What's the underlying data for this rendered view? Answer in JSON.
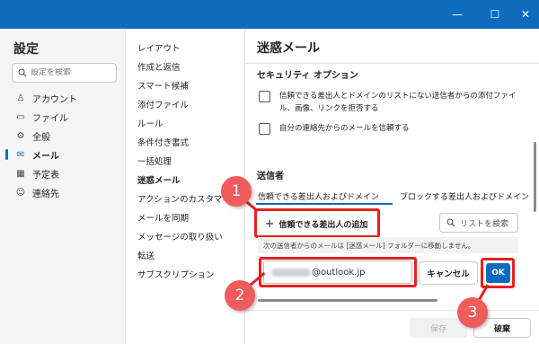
{
  "window": {
    "minimize_glyph": "—",
    "maximize_glyph": "☐",
    "close_glyph": "✕",
    "accent": "#0f6cbd"
  },
  "left": {
    "title": "設定",
    "search_placeholder": "設定を検索",
    "items": [
      {
        "label": "アカウント",
        "icon": "person-icon",
        "glyph": "♙"
      },
      {
        "label": "ファイル",
        "icon": "folder-icon",
        "glyph": "▭"
      },
      {
        "label": "全般",
        "icon": "gear-icon",
        "glyph": "⚙"
      },
      {
        "label": "メール",
        "icon": "mail-icon",
        "glyph": "✉",
        "active": true
      },
      {
        "label": "予定表",
        "icon": "calendar-icon",
        "glyph": "▦"
      },
      {
        "label": "連絡先",
        "icon": "contacts-icon",
        "glyph": "☺"
      }
    ]
  },
  "middle": {
    "items": [
      "レイアウト",
      "作成と返信",
      "スマート候補",
      "添付ファイル",
      "ルール",
      "条件付き書式",
      "一括処理",
      "迷惑メール",
      "アクションのカスタマイズ",
      "メールを同期",
      "メッセージの取り扱い",
      "転送",
      "サブスクリプション"
    ],
    "active_index": 7
  },
  "right": {
    "title": "迷惑メール",
    "security_title": "セキュリティ オプション",
    "option1": "信頼できる差出人とドメインのリストにない送信者からの添付ファイル、画像、リンクを拒否する",
    "option2": "自分の連絡先からのメールを信頼する",
    "sender_title": "送信者",
    "tab_trusted": "信頼できる差出人およびドメイン",
    "tab_blocked": "ブロックする差出人およびドメイン",
    "add_button": "信頼できる差出人の追加",
    "add_glyph": "+",
    "list_search_placeholder": "リストを検索",
    "info_text": "次の送信者からのメールは [迷惑メール] フォルダーに移動しません。",
    "email_value": "@outlook.jp",
    "cancel_button": "キャンセル",
    "ok_button": "OK",
    "save_button": "保存",
    "discard_button": "破棄"
  },
  "annotations": {
    "color": "#f05b5b",
    "line_color": "#e6211b",
    "steps": [
      "1",
      "2",
      "3"
    ]
  }
}
